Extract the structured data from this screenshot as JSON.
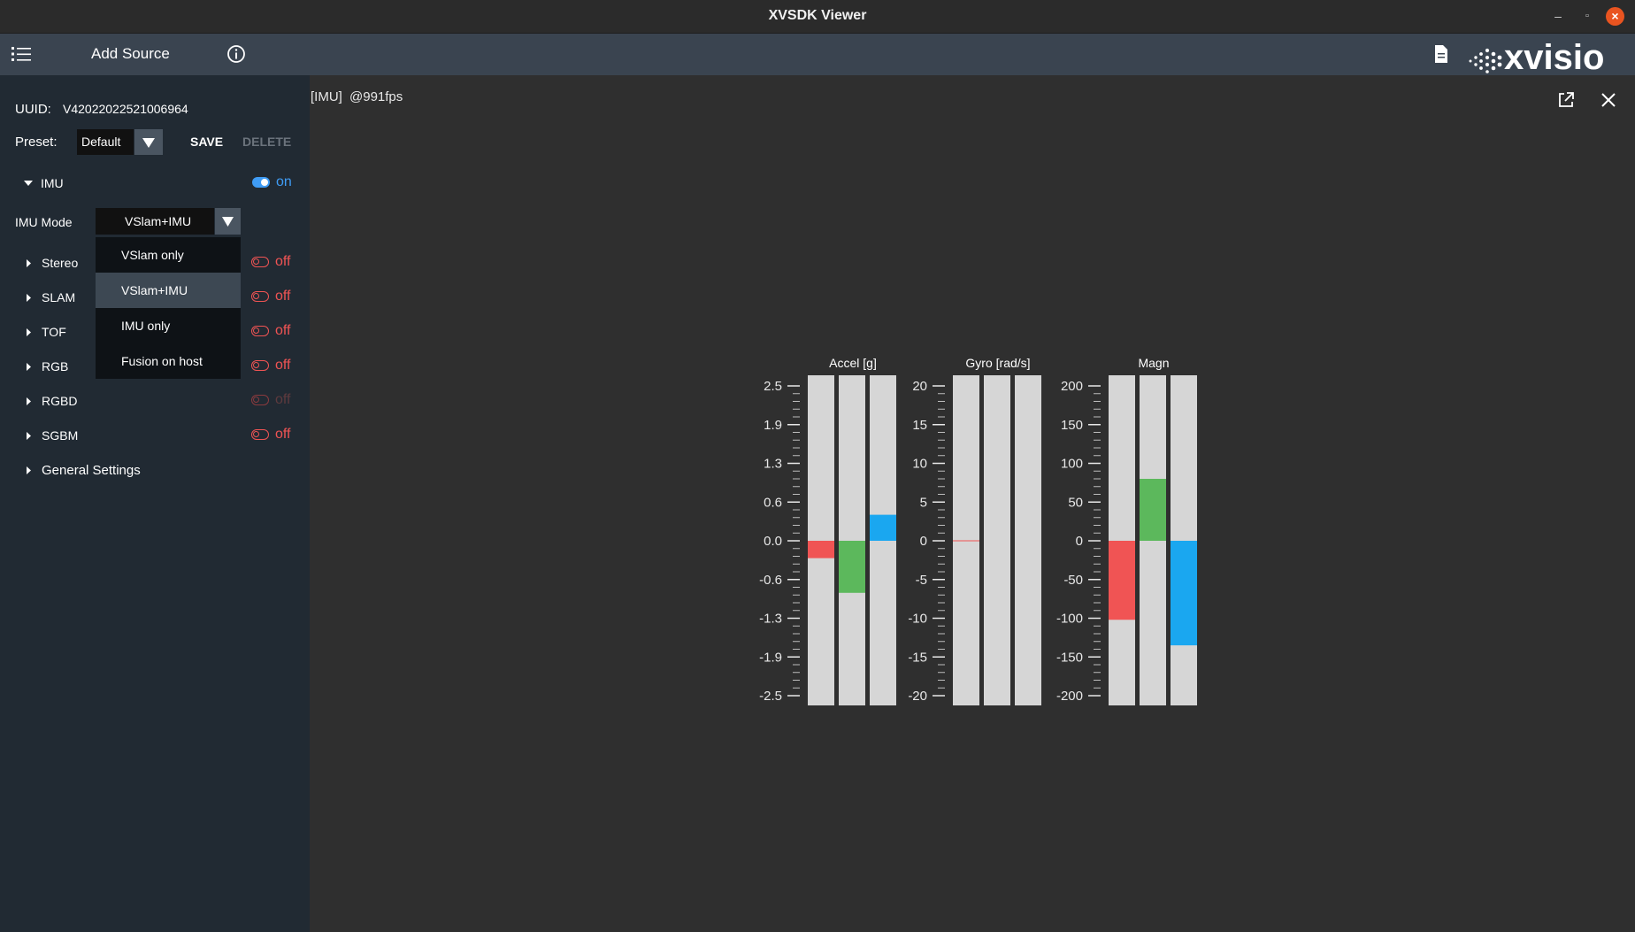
{
  "window": {
    "title": "XVSDK Viewer"
  },
  "toolbar": {
    "add_source": "Add Source",
    "logo_text": "xvisio"
  },
  "sidebar": {
    "uuid_label": "UUID:",
    "uuid_value": "V42022022521006964",
    "preset_label": "Preset:",
    "preset_value": "Default",
    "save_label": "SAVE",
    "delete_label": "DELETE",
    "imu": {
      "label": "IMU",
      "state": "on"
    },
    "imu_mode_label": "IMU Mode",
    "imu_mode_value": "VSlam+IMU",
    "imu_mode_options": [
      "VSlam only",
      "VSlam+IMU",
      "IMU only",
      "Fusion on host"
    ],
    "sections": [
      {
        "label": "Stereo",
        "state": "off"
      },
      {
        "label": "SLAM",
        "state": "off"
      },
      {
        "label": "TOF",
        "state": "off"
      },
      {
        "label": "RGB",
        "state": "off"
      },
      {
        "label": "RGBD",
        "state": "off"
      },
      {
        "label": "SGBM",
        "state": "off"
      }
    ],
    "general_settings": "General Settings"
  },
  "viewer": {
    "tag": "[IMU]",
    "fps": "@991fps"
  },
  "colors": {
    "red": "#f05454",
    "green": "#5cb85c",
    "blue": "#1aa7f0",
    "on": "#3f9cf5",
    "off": "#f05454",
    "track": "#d6d6d6"
  },
  "chart_data": [
    {
      "type": "bar",
      "title": "Accel [g]",
      "ylim": [
        -2.5,
        2.5
      ],
      "ticks": [
        "2.5",
        "1.9",
        "1.3",
        "0.6",
        "0.0",
        "-0.6",
        "-1.3",
        "-1.9",
        "-2.5"
      ],
      "values": [
        -0.28,
        -0.84,
        0.42
      ],
      "colors": [
        "#f05454",
        "#5cb85c",
        "#1aa7f0"
      ]
    },
    {
      "type": "bar",
      "title": "Gyro [rad/s]",
      "ylim": [
        -20,
        20
      ],
      "ticks": [
        "20",
        "15",
        "10",
        "5",
        "0",
        "-5",
        "-10",
        "-15",
        "-20"
      ],
      "values": [
        0.0,
        0.0,
        0.0
      ],
      "colors": [
        "#f05454",
        "#5cb85c",
        "#1aa7f0"
      ]
    },
    {
      "type": "bar",
      "title": "Magn",
      "ylim": [
        -200,
        200
      ],
      "ticks": [
        "200",
        "150",
        "100",
        "50",
        "0",
        "-50",
        "-100",
        "-150",
        "-200"
      ],
      "values": [
        -102,
        80,
        -135
      ],
      "colors": [
        "#f05454",
        "#5cb85c",
        "#1aa7f0"
      ]
    }
  ]
}
